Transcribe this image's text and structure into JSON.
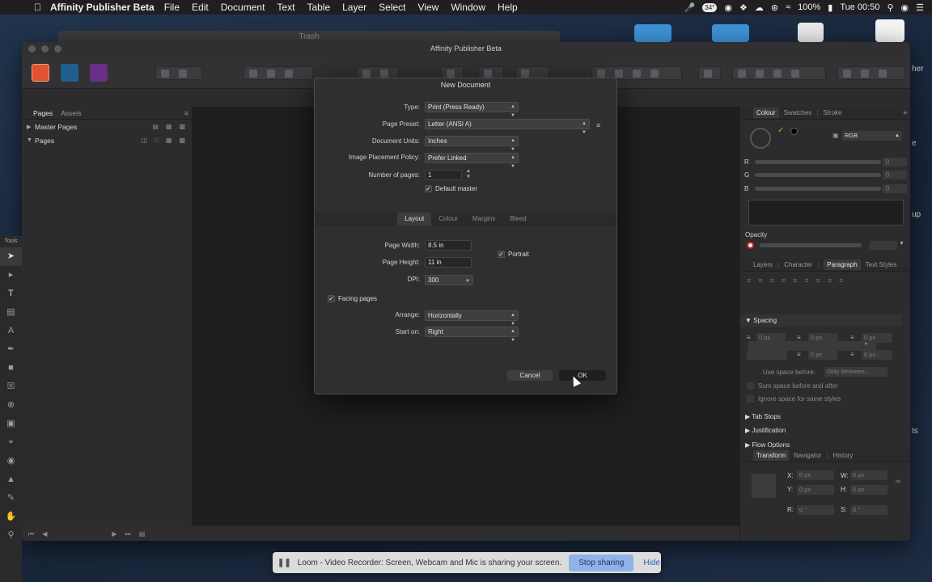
{
  "menubar": {
    "app_name": "Affinity Publisher Beta",
    "items": [
      "File",
      "Edit",
      "Document",
      "Text",
      "Table",
      "Layer",
      "Select",
      "View",
      "Window",
      "Help"
    ],
    "status": {
      "temp_badge": "34°",
      "battery": "100%",
      "clock": "Tue 00:50"
    }
  },
  "desktop": {
    "trash_window_title": "Trash",
    "edge_texts": [
      "her",
      "e",
      "up",
      "ts"
    ]
  },
  "window": {
    "title": "Affinity Publisher Beta"
  },
  "left_panel": {
    "tabs": [
      "Pages",
      "Assets"
    ],
    "rows": [
      {
        "label": "Master Pages"
      },
      {
        "label": "Pages"
      }
    ]
  },
  "tools_label": "Tools",
  "right_panel": {
    "colour_tabs": [
      "Colour",
      "Swatches",
      "Stroke"
    ],
    "colour_model": "RGB",
    "channels": [
      {
        "label": "R",
        "value": "0"
      },
      {
        "label": "G",
        "value": "0"
      },
      {
        "label": "B",
        "value": "0"
      }
    ],
    "opacity_label": "Opacity",
    "text_tabs": [
      "Layers",
      "Character",
      "Paragraph",
      "Text Styles"
    ],
    "spacing_header": "Spacing",
    "spacing_values": [
      "0 px",
      "0 px",
      "0 px",
      "0 px",
      "0 px"
    ],
    "use_space_before_label": "Use space before:",
    "use_space_before_value": "Only Between...",
    "sum_space_label": "Sum space before and after",
    "ignore_space_label": "Ignore space for same styles",
    "sections": [
      "Tab Stops",
      "Justification",
      "Flow Options"
    ],
    "transform_tabs": [
      "Transform",
      "Navigator",
      "History"
    ],
    "transform": {
      "x_label": "X:",
      "x": "0 px",
      "y_label": "Y:",
      "y": "0 px",
      "w_label": "W:",
      "w": "0 px",
      "h_label": "H:",
      "h": "0 px",
      "r_label": "R:",
      "r": "0 °",
      "s_label": "S:",
      "s": "0 °"
    }
  },
  "dialog": {
    "title": "New Document",
    "type_label": "Type:",
    "type_value": "Print (Press Ready)",
    "preset_label": "Page Preset:",
    "preset_value": "Letter (ANSI A)",
    "units_label": "Document Units:",
    "units_value": "Inches",
    "placement_label": "Image Placement Policy:",
    "placement_value": "Prefer Linked",
    "pages_label": "Number of pages:",
    "pages_value": "1",
    "default_master_label": "Default master",
    "default_master_checked": true,
    "tabs": [
      "Layout",
      "Colour",
      "Margins",
      "Bleed"
    ],
    "width_label": "Page Width:",
    "width_value": "8.5 in",
    "height_label": "Page Height:",
    "height_value": "11 in",
    "dpi_label": "DPI:",
    "dpi_value": "300",
    "portrait_label": "Portrait",
    "portrait_checked": true,
    "facing_label": "Facing pages",
    "facing_checked": true,
    "arrange_label": "Arrange:",
    "arrange_value": "Horizontally",
    "start_label": "Start on:",
    "start_value": "Right",
    "cancel_label": "Cancel",
    "ok_label": "OK"
  },
  "loom": {
    "message": "Loom - Video Recorder: Screen, Webcam and Mic is sharing your screen.",
    "stop_label": "Stop sharing",
    "hide_label": "Hide"
  },
  "colors": {
    "accent": "#8fb2e8",
    "ok_button": "#1f1f21"
  }
}
